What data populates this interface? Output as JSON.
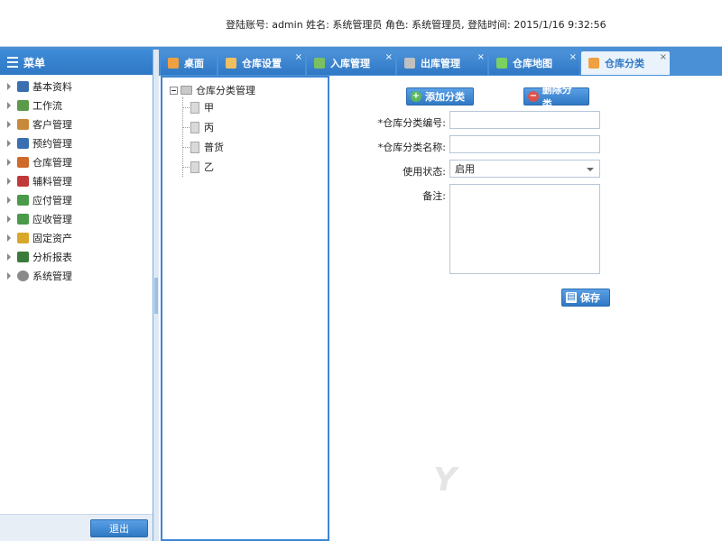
{
  "header": {
    "login_info": "登陆账号: admin 姓名: 系统管理员 角色: 系统管理员, 登陆时间: 2015/1/16 9:32:56"
  },
  "sidebar": {
    "title": "菜单",
    "items": [
      {
        "label": "基本资料",
        "icon": "book-icon",
        "color": "#3a6fb0"
      },
      {
        "label": "工作流",
        "icon": "workflow-icon",
        "color": "#5a9a4a"
      },
      {
        "label": "客户管理",
        "icon": "customer-icon",
        "color": "#c88a3a"
      },
      {
        "label": "预约管理",
        "icon": "appointment-icon",
        "color": "#3a6fb0"
      },
      {
        "label": "仓库管理",
        "icon": "warehouse-icon",
        "color": "#d06a2a"
      },
      {
        "label": "辅料管理",
        "icon": "materials-icon",
        "color": "#c03a3a"
      },
      {
        "label": "应付管理",
        "icon": "payable-icon",
        "color": "#4a9a4a"
      },
      {
        "label": "应收管理",
        "icon": "receivable-icon",
        "color": "#4a9a4a"
      },
      {
        "label": "固定资产",
        "icon": "asset-icon",
        "color": "#d9a72a"
      },
      {
        "label": "分析报表",
        "icon": "report-icon",
        "color": "#3a7a3a"
      },
      {
        "label": "系统管理",
        "icon": "gear-icon",
        "color": "#8a8a8a"
      }
    ],
    "logout_label": "退出"
  },
  "tabs": [
    {
      "label": "桌面",
      "icon": "home-icon",
      "color": "#f0a040",
      "closable": false,
      "active": false
    },
    {
      "label": "仓库设置",
      "icon": "warehouse-icon",
      "color": "#f0c060",
      "closable": true,
      "active": false
    },
    {
      "label": "入库管理",
      "icon": "inbound-icon",
      "color": "#7ac060",
      "closable": true,
      "active": false
    },
    {
      "label": "出库管理",
      "icon": "outbound-icon",
      "color": "#c0c0c0",
      "closable": true,
      "active": false
    },
    {
      "label": "仓库地图",
      "icon": "dollar-icon",
      "color": "#7ad060",
      "closable": true,
      "active": false
    },
    {
      "label": "仓库分类",
      "icon": "category-icon",
      "color": "#f0a040",
      "closable": true,
      "active": true
    }
  ],
  "tree": {
    "root": "仓库分类管理",
    "children": [
      "甲",
      "丙",
      "普货",
      "乙"
    ]
  },
  "form": {
    "add_button": "添加分类",
    "delete_button": "删除分类",
    "code_label": "*仓库分类编号:",
    "code_value": "",
    "name_label": "*仓库分类名称:",
    "name_value": "",
    "status_label": "使用状态:",
    "status_value": "启用",
    "remark_label": "备注:",
    "save_button": "保存"
  },
  "colors": {
    "accent": "#2f78c4",
    "band": "#4a90d6",
    "active_tab_bg": "#eaf3fc"
  }
}
